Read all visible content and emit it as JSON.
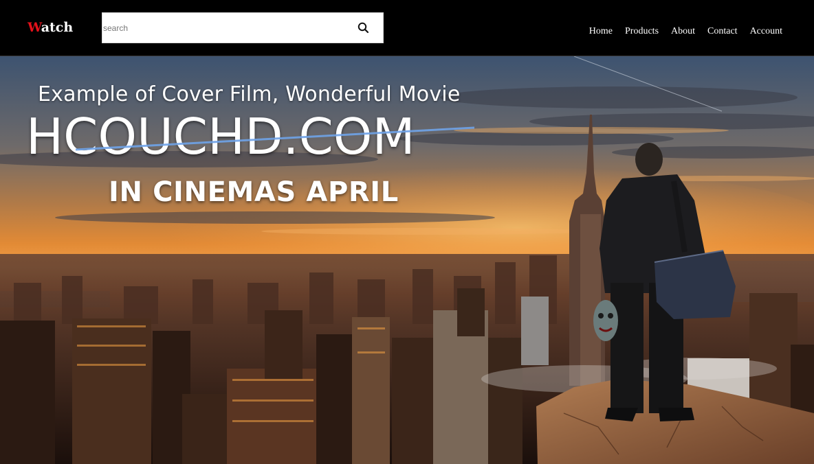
{
  "navbar": {
    "logo": {
      "first_letter": "W",
      "rest": "atch"
    },
    "search": {
      "placeholder": "search",
      "value": "",
      "icon": "search-icon"
    },
    "links": [
      "Home",
      "Products",
      "About",
      "Contact",
      "Account"
    ]
  },
  "hero": {
    "subtitle": "Example of Cover Film, Wonderful Movie",
    "brand": "HCOUCHD.COM",
    "tagline": "IN CINEMAS APRIL"
  },
  "colors": {
    "navbar_bg": "#000000",
    "logo_accent": "#e4111a",
    "text": "#ffffff",
    "search_bg": "#ffffff"
  }
}
